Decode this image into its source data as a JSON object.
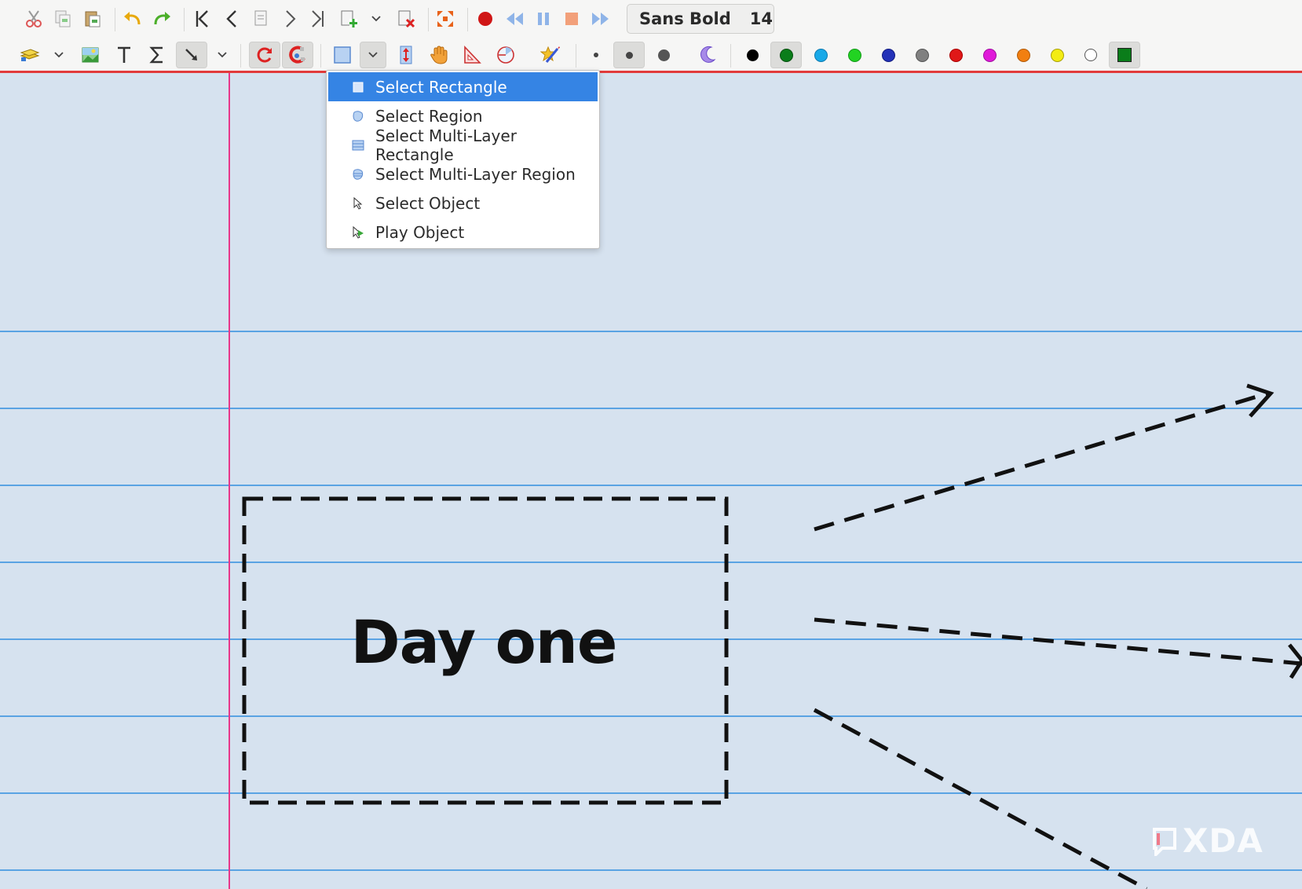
{
  "font": {
    "name": "Sans Bold",
    "size": "14"
  },
  "colors": {
    "palette": [
      "#000000",
      "#0a7d1a",
      "#18a9e8",
      "#22d322",
      "#2432b8",
      "#808080",
      "#e01818",
      "#e01ad9",
      "#f27f10",
      "#f3ec14",
      "#ffffff",
      "#0a7d1a"
    ],
    "margin_line": "#e8378a",
    "ruled_line": "#5aa3e3",
    "page_background": "#d6e2ef"
  },
  "toolbar_row1_icons": [
    "cut-icon",
    "copy-icon",
    "paste-icon",
    "undo-icon",
    "redo-icon",
    "first-page-icon",
    "previous-page-icon",
    "page-jump-icon",
    "next-page-icon",
    "last-page-icon",
    "add-page-icon",
    "delete-page-icon",
    "fullscreen-icon",
    "record-icon",
    "rewind-icon",
    "pause-icon",
    "stop-icon",
    "fast-forward-icon"
  ],
  "toolbar_row2_icons": [
    "layer-icon",
    "image-icon",
    "text-icon",
    "math-tex-icon",
    "vertical-space-icon",
    "rotation-snap-icon",
    "grid-snap-icon",
    "select-rectangle-icon",
    "vertical-space-tool-icon",
    "hand-tool-icon",
    "setsquare-icon",
    "compass-icon",
    "shape-recognizer-icon",
    "fine-pen-icon",
    "medium-pen-icon",
    "thick-pen-icon",
    "select-color-icon"
  ],
  "select_menu": {
    "items": [
      {
        "label": "Select Rectangle",
        "icon": "select-rectangle-icon",
        "active": true
      },
      {
        "label": "Select Region",
        "icon": "select-region-icon",
        "active": false
      },
      {
        "label": "Select Multi-Layer Rectangle",
        "icon": "select-multilayer-rectangle-icon",
        "active": false
      },
      {
        "label": "Select Multi-Layer Region",
        "icon": "select-multilayer-region-icon",
        "active": false
      },
      {
        "label": "Select Object",
        "icon": "select-object-icon",
        "active": false
      },
      {
        "label": "Play Object",
        "icon": "play-object-icon",
        "active": false
      }
    ]
  },
  "canvas": {
    "text": "Day one"
  },
  "watermark": {
    "text": "XDA"
  }
}
